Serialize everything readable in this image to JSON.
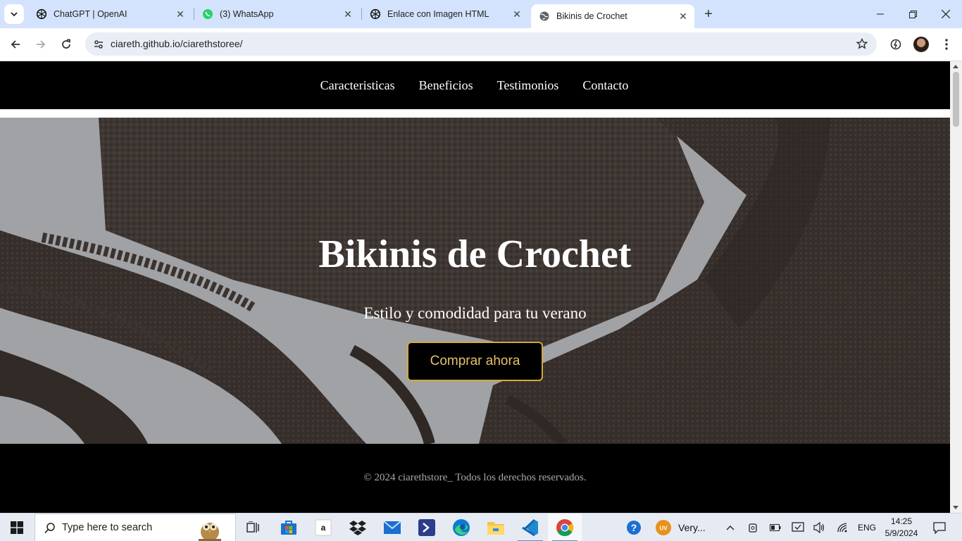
{
  "browser": {
    "tabs": [
      {
        "title": "ChatGPT | OpenAI",
        "icon": "openai-icon",
        "active": false
      },
      {
        "title": "(3) WhatsApp",
        "icon": "whatsapp-icon",
        "active": false
      },
      {
        "title": "Enlace con Imagen HTML",
        "icon": "openai-icon",
        "active": false
      },
      {
        "title": "Bikinis de Crochet",
        "icon": "globe-icon",
        "active": true
      }
    ],
    "url": "ciareth.github.io/ciarethstoree/"
  },
  "page": {
    "nav": [
      "Caracteristicas",
      "Beneficios",
      "Testimonios",
      "Contacto"
    ],
    "hero": {
      "title": "Bikinis de Crochet",
      "subtitle": "Estilo y comodidad para tu verano",
      "cta": "Comprar ahora"
    },
    "footer": "© 2024 ciarethstore_ Todos los derechos reservados.",
    "colors": {
      "nav_bg": "#000000",
      "cta_border": "#d4a93c",
      "cta_text": "#e6c069",
      "footer_text": "#a9a9a9"
    }
  },
  "taskbar": {
    "search_placeholder": "Type here to search",
    "weather_label": "Very...",
    "weather_badge": "UV",
    "language": "ENG",
    "time": "14:25",
    "date": "5/9/2024",
    "amazon_glyph": "a"
  }
}
